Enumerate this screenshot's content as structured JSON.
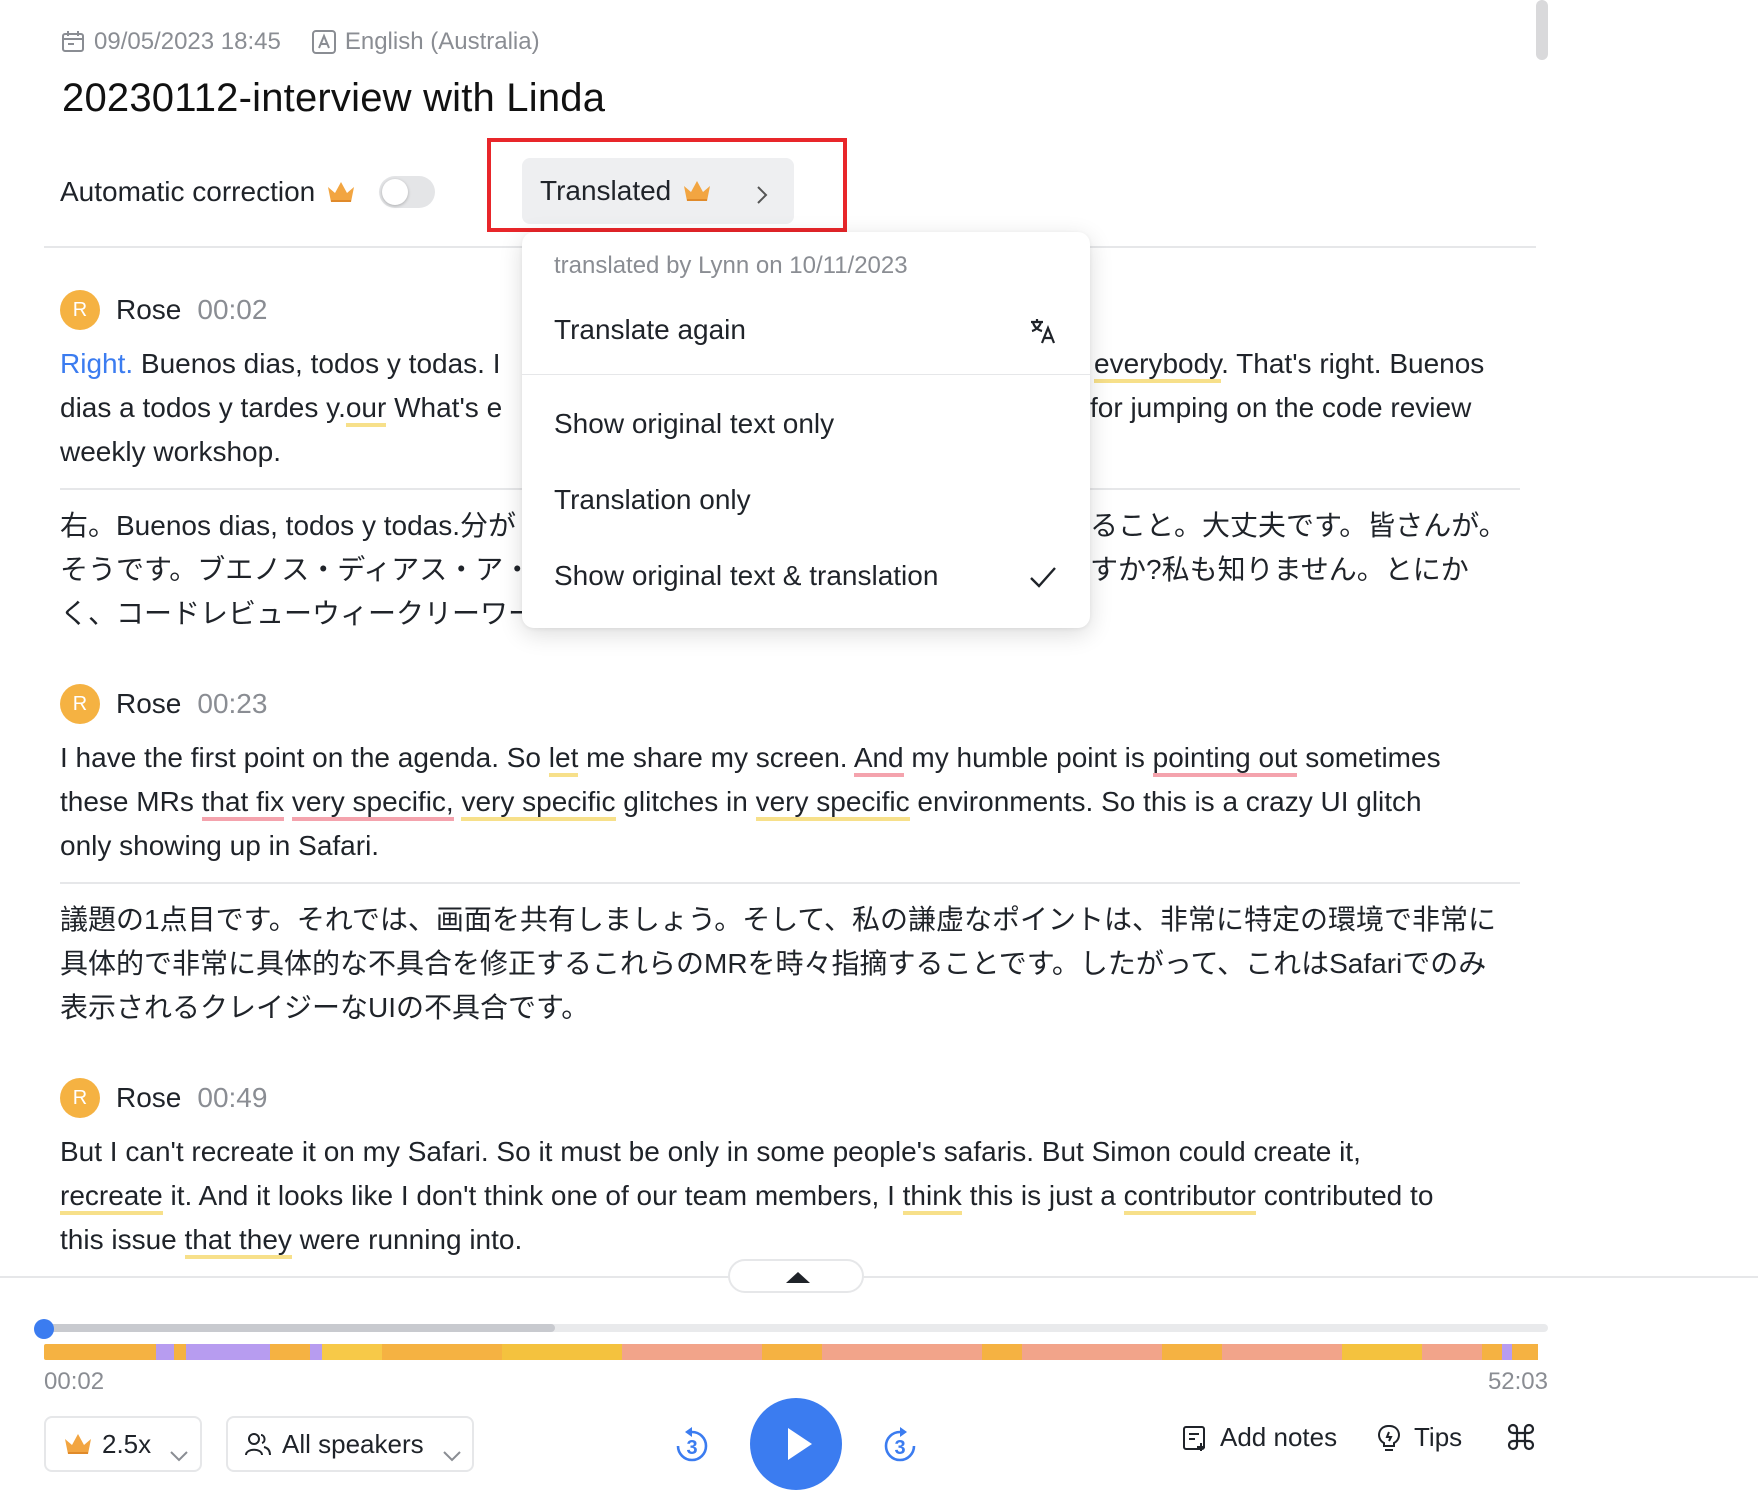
{
  "meta": {
    "datetime": "09/05/2023 18:45",
    "language": "English (Australia)"
  },
  "title": "20230112-interview with Linda",
  "controls": {
    "auto_correction_label": "Automatic correction",
    "auto_correction_on": false,
    "translated_label": "Translated"
  },
  "dropdown": {
    "header": "translated by Lynn on 10/11/2023",
    "translate_again": "Translate again",
    "options": [
      "Show original text only",
      "Translation only",
      "Show original text & translation"
    ],
    "selected_index": 2
  },
  "segments": [
    {
      "avatar": "R",
      "speaker": "Rose",
      "time": "00:02",
      "original_a": "Right.",
      "original_b": " Buenos dias, todos y todas. I",
      "original_c": "everybody",
      "original_d": ". That's right. Buenos",
      "original_line2a": "dias a todos y tardes y.",
      "original_line2b": "our",
      "original_line2c": " What's e",
      "original_line2d": "for jumping on the code review",
      "original_line3": "weekly workshop.",
      "translation_l1a": "右。Buenos dias, todos y todas.分が",
      "translation_l1b": "ること。大丈夫です。皆さんが。",
      "translation_l2a": "そうです。ブエノス・ディアス・ア・",
      "translation_l2b": "すか?私も知りません。とにか",
      "translation_l3": "く、コードレビューウィークリーワー"
    },
    {
      "avatar": "R",
      "speaker": "Rose",
      "time": "00:23",
      "t1": "I have the first point on the agenda. So ",
      "t2": "let",
      "t3": " me share my screen. ",
      "t4": "And",
      "t5": " my humble point is ",
      "t6": "pointing out",
      "t7": " sometimes",
      "t8": "these MRs ",
      "t9": "that fix",
      "t10": " ",
      "t11": "very specific,",
      "t12": " ",
      "t13": "very specific",
      "t14": " glitches in ",
      "t15": "very specific",
      "t16": " environments. So this is a crazy UI glitch",
      "t17": "only showing up in Safari.",
      "translation_l1": "議題の1点目です。それでは、画面を共有しましょう。そして、私の謙虚なポイントは、非常に特定の環境で非常に",
      "translation_l2": "具体的で非常に具体的な不具合を修正するこれらのMRを時々指摘することです。したがって、これはSafariでのみ",
      "translation_l3": "表示されるクレイジーなUIの不具合です。"
    },
    {
      "avatar": "R",
      "speaker": "Rose",
      "time": "00:49",
      "t1": "But I can't recreate it on my Safari. So it must be only in some people's safaris. But Simon could create it,",
      "t2": "recreate",
      "t3": " it. And it looks like I don't think one of our team members, I ",
      "t4": "think",
      "t5": " this is just a ",
      "t6": "contributor",
      "t7": " contributed to",
      "t8": "this issue ",
      "t9": "that they",
      "t10": " were running into."
    }
  ],
  "player": {
    "current_time": "00:02",
    "total_time": "52:03",
    "played_fraction": 0.34,
    "speed_label": "2.5x",
    "speakers_label": "All speakers",
    "skip_back_seconds": "3",
    "skip_forward_seconds": "3",
    "add_notes_label": "Add notes",
    "tips_label": "Tips"
  },
  "colors": {
    "accent": "#3b7cf0",
    "highlight_box": "#e8262a",
    "avatar": "#f5b242",
    "underline_yellow": "#f7e08a",
    "underline_pink": "#f4a3ad"
  }
}
